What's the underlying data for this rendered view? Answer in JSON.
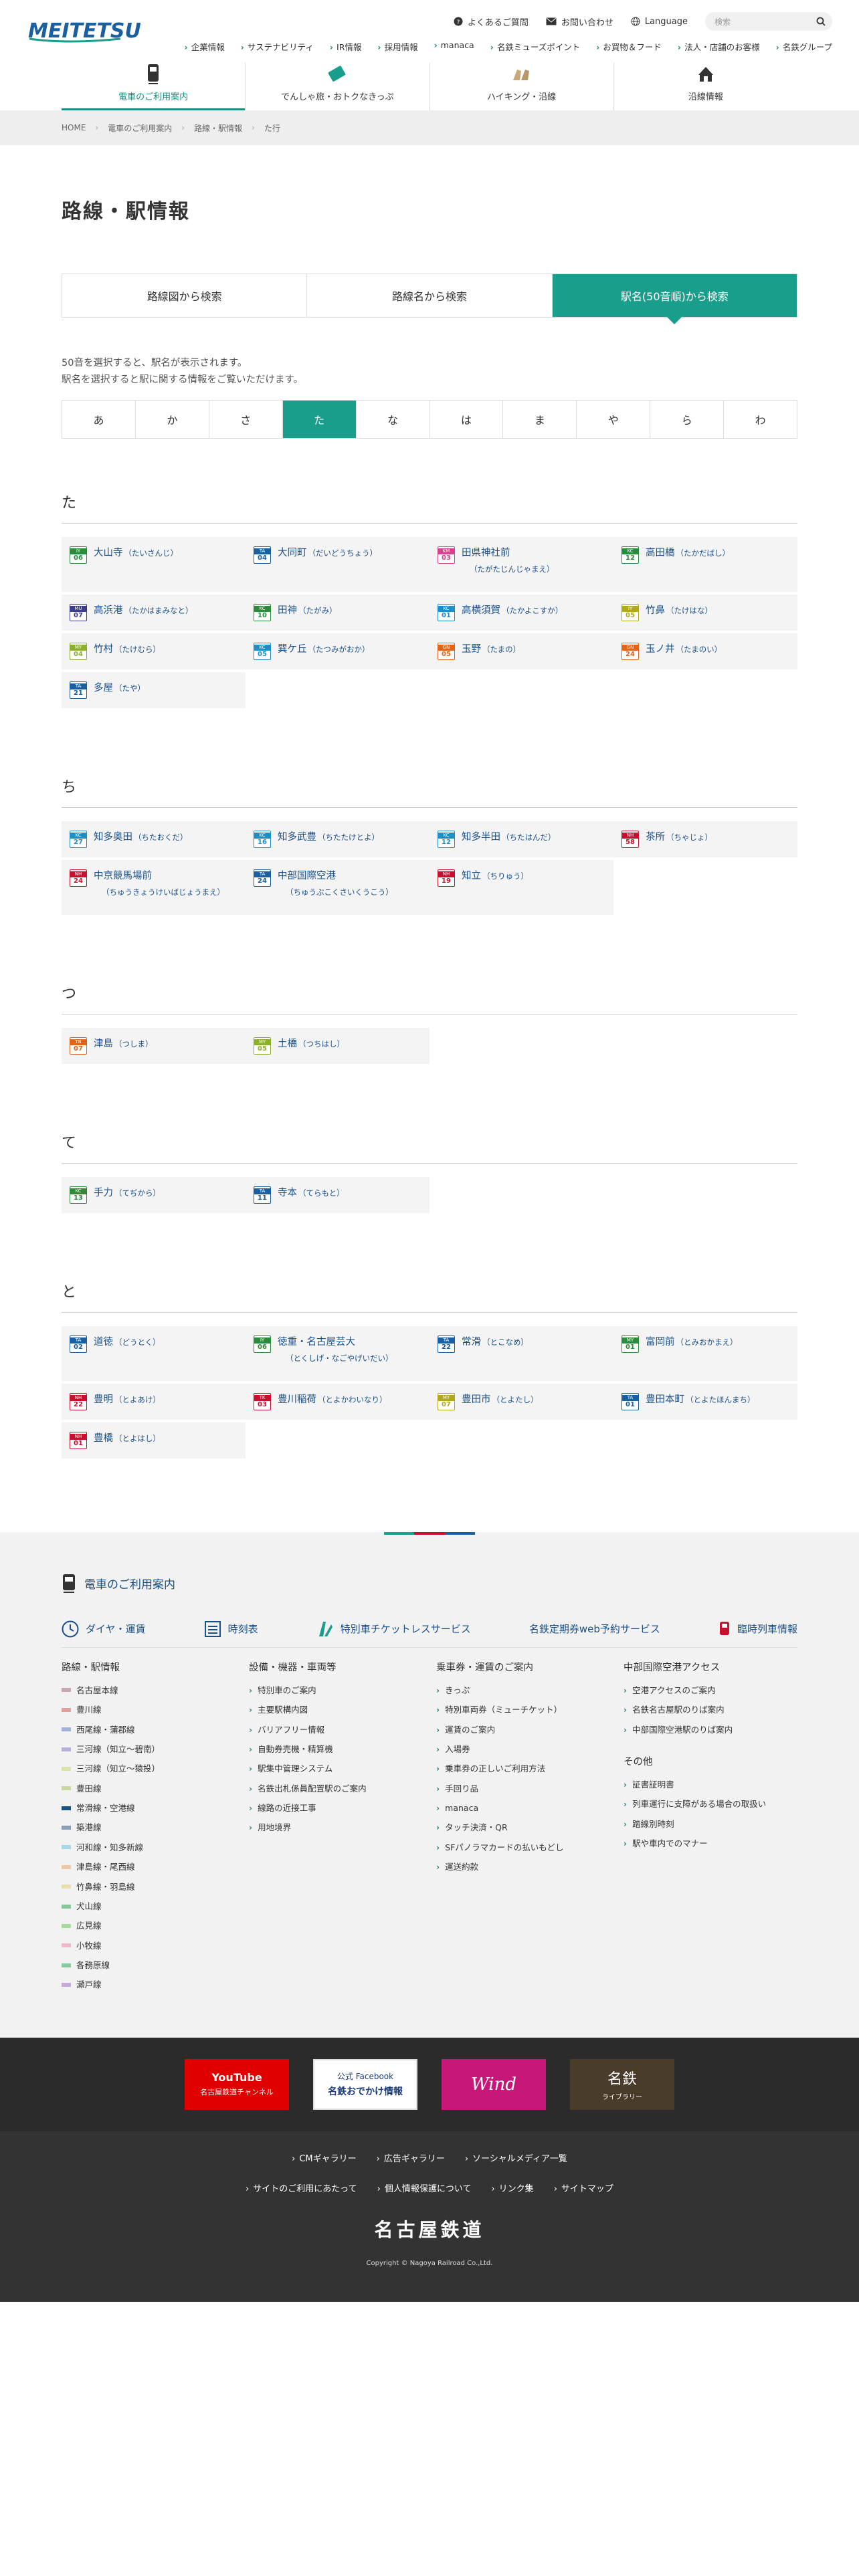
{
  "header": {
    "logo_text": "MEITETSU",
    "utils": [
      "よくあるご質問",
      "お問い合わせ",
      "Language"
    ],
    "search_placeholder": "検索",
    "subnav": [
      "企業情報",
      "サステナビリティ",
      "IR情報",
      "採用情報",
      "manaca",
      "名鉄ミューズポイント",
      "お買物＆フード",
      "法人・店舗のお客様",
      "名鉄グループ"
    ],
    "mainnav": [
      "電車のご利用案内",
      "でんしゃ旅・おトクなきっぷ",
      "ハイキング・沿線",
      "沿線情報"
    ]
  },
  "breadcrumb": [
    "HOME",
    "電車のご利用案内",
    "路線・駅情報",
    "た行"
  ],
  "page_title": "路線・駅情報",
  "tabs": [
    "路線図から検索",
    "路線名から検索",
    "駅名(50音順)から検索"
  ],
  "desc": [
    "50音を選択すると、駅名が表示されます。",
    "駅名を選択すると駅に関する情報をご覧いただけます。"
  ],
  "kana": [
    "あ",
    "か",
    "さ",
    "た",
    "な",
    "は",
    "ま",
    "や",
    "ら",
    "わ"
  ],
  "groups": [
    {
      "heading": "た",
      "stations": [
        {
          "code": "IY",
          "num": "06",
          "name": "大山寺",
          "reading": "（たいさんじ）",
          "color": "#2a8c3a"
        },
        {
          "code": "TA",
          "num": "04",
          "name": "大同町",
          "reading": "（だいどうちょう）",
          "color": "#1a5fa0"
        },
        {
          "code": "KM",
          "num": "03",
          "name": "田県神社前",
          "reading": "（たがたじんじゃまえ）",
          "color": "#d4418e",
          "tall": true
        },
        {
          "code": "KC",
          "num": "12",
          "name": "高田橋",
          "reading": "（たかだばし）",
          "color": "#2a8c3a"
        },
        {
          "code": "MU",
          "num": "07",
          "name": "高浜港",
          "reading": "（たかはまみなと）",
          "color": "#3d3d8f"
        },
        {
          "code": "KC",
          "num": "10",
          "name": "田神",
          "reading": "（たがみ）",
          "color": "#2a8c3a"
        },
        {
          "code": "KC",
          "num": "01",
          "name": "高横須賀",
          "reading": "（たかよこすか）",
          "color": "#1a8fc9"
        },
        {
          "code": "IY",
          "num": "05",
          "name": "竹鼻",
          "reading": "（たけはな）",
          "color": "#b0a91e"
        },
        {
          "code": "MY",
          "num": "04",
          "name": "竹村",
          "reading": "（たけむら）",
          "color": "#8ab02c"
        },
        {
          "code": "KC",
          "num": "05",
          "name": "巽ケ丘",
          "reading": "（たつみがおか）",
          "color": "#1a8fc9"
        },
        {
          "code": "GN",
          "num": "05",
          "name": "玉野",
          "reading": "（たまの）",
          "color": "#e0641a"
        },
        {
          "code": "GN",
          "num": "24",
          "name": "玉ノ井",
          "reading": "（たまのい）",
          "color": "#e0641a"
        },
        {
          "code": "TA",
          "num": "21",
          "name": "多屋",
          "reading": "（たや）",
          "color": "#1a5fa0"
        }
      ]
    },
    {
      "heading": "ち",
      "stations": [
        {
          "code": "KC",
          "num": "27",
          "name": "知多奥田",
          "reading": "（ちたおくだ）",
          "color": "#1a8fc9"
        },
        {
          "code": "KC",
          "num": "16",
          "name": "知多武豊",
          "reading": "（ちたたけとよ）",
          "color": "#1a8fc9"
        },
        {
          "code": "KC",
          "num": "12",
          "name": "知多半田",
          "reading": "（ちたはんだ）",
          "color": "#1a8fc9"
        },
        {
          "code": "NH",
          "num": "58",
          "name": "茶所",
          "reading": "（ちゃじょ）",
          "color": "#c8102e"
        },
        {
          "code": "NH",
          "num": "24",
          "name": "中京競馬場前",
          "reading": "（ちゅうきょうけいばじょうまえ）",
          "color": "#c8102e",
          "tall": true
        },
        {
          "code": "TA",
          "num": "24",
          "name": "中部国際空港",
          "reading": "（ちゅうぶこくさいくうこう）",
          "color": "#1a5fa0",
          "tall": true
        },
        {
          "code": "NH",
          "num": "19",
          "name": "知立",
          "reading": "（ちりゅう）",
          "color": "#c8102e"
        }
      ]
    },
    {
      "heading": "つ",
      "stations": [
        {
          "code": "TB",
          "num": "07",
          "name": "津島",
          "reading": "（つしま）",
          "color": "#e0641a"
        },
        {
          "code": "MY",
          "num": "05",
          "name": "土橋",
          "reading": "（つちはし）",
          "color": "#8ab02c"
        }
      ]
    },
    {
      "heading": "て",
      "stations": [
        {
          "code": "KC",
          "num": "13",
          "name": "手力",
          "reading": "（てぢから）",
          "color": "#2a8c3a"
        },
        {
          "code": "TA",
          "num": "11",
          "name": "寺本",
          "reading": "（てらもと）",
          "color": "#1a5fa0"
        }
      ]
    },
    {
      "heading": "と",
      "stations": [
        {
          "code": "TA",
          "num": "02",
          "name": "道徳",
          "reading": "（どうとく）",
          "color": "#1a5fa0"
        },
        {
          "code": "IY",
          "num": "06",
          "name": "徳重・名古屋芸大",
          "reading": "（とくしげ・なごやげいだい）",
          "color": "#2a8c3a",
          "tall": true
        },
        {
          "code": "TA",
          "num": "22",
          "name": "常滑",
          "reading": "（とこなめ）",
          "color": "#1a5fa0"
        },
        {
          "code": "MY",
          "num": "01",
          "name": "富岡前",
          "reading": "（とみおかまえ）",
          "color": "#2a8c3a"
        },
        {
          "code": "NH",
          "num": "22",
          "name": "豊明",
          "reading": "（とよあけ）",
          "color": "#c8102e"
        },
        {
          "code": "TK",
          "num": "03",
          "name": "豊川稲荷",
          "reading": "（とよかわいなり）",
          "color": "#c8102e"
        },
        {
          "code": "MY",
          "num": "07",
          "name": "豊田市",
          "reading": "（とよたし）",
          "color": "#b0a91e"
        },
        {
          "code": "TA",
          "num": "01",
          "name": "豊田本町",
          "reading": "（とよたほんまち）",
          "color": "#1a5fa0"
        },
        {
          "code": "NH",
          "num": "01",
          "name": "豊橋",
          "reading": "（とよはし）",
          "color": "#c8102e"
        }
      ]
    }
  ],
  "footer_nav": {
    "title": "電車のご利用案内",
    "links": [
      "ダイヤ・運賃",
      "時刻表",
      "特別車チケットレスサービス",
      "名鉄定期券web予約サービス",
      "臨時列車情報"
    ],
    "col1": {
      "heading": "路線・駅情報",
      "items": [
        {
          "label": "名古屋本線",
          "color": "#c8a7b0"
        },
        {
          "label": "豊川線",
          "color": "#e0a0a0"
        },
        {
          "label": "西尾線・蒲郡線",
          "color": "#a0b4d8"
        },
        {
          "label": "三河線（知立〜碧南）",
          "color": "#b8b0d8"
        },
        {
          "label": "三河線（知立〜猿投）",
          "color": "#dce3a8"
        },
        {
          "label": "豊田線",
          "color": "#c8d8a0"
        },
        {
          "label": "常滑線・空港線",
          "color": "#1a4f8a"
        },
        {
          "label": "築港線",
          "color": "#8aa0b8"
        },
        {
          "label": "河和線・知多新線",
          "color": "#a8d8e8"
        },
        {
          "label": "津島線・尾西線",
          "color": "#f0c8a8"
        },
        {
          "label": "竹鼻線・羽島線",
          "color": "#e8e0a8"
        },
        {
          "label": "犬山線",
          "color": "#88c898"
        },
        {
          "label": "広見線",
          "color": "#a8d8a0"
        },
        {
          "label": "小牧線",
          "color": "#f0b8c8"
        },
        {
          "label": "各務原線",
          "color": "#8ac8a0"
        },
        {
          "label": "瀬戸線",
          "color": "#c8a8d8"
        }
      ]
    },
    "col2": {
      "heading": "設備・機器・車両等",
      "items": [
        "特別車のご案内",
        "主要駅構内図",
        "バリアフリー情報",
        "自動券売機・精算機",
        "駅集中管理システム",
        "名鉄出札係員配置駅のご案内",
        "線路の近接工事",
        "用地境界"
      ]
    },
    "col3": {
      "heading": "乗車券・運賃のご案内",
      "items": [
        "きっぷ",
        "特別車両券（ミューチケット）",
        "運賃のご案内",
        "入場券",
        "乗車券の正しいご利用方法",
        "手回り品",
        "manaca",
        "タッチ決済・QR",
        "SFパノラマカードの払いもどし",
        "運送約款"
      ]
    },
    "col4": {
      "heading": "中部国際空港アクセス",
      "items": [
        "空港アクセスのご案内",
        "名鉄名古屋駅のりば案内",
        "中部国際空港駅のりば案内"
      ],
      "heading2": "その他",
      "items2": [
        "証書証明書",
        "列車運行に支障がある場合の取扱い",
        "踏線別時刻",
        "駅や車内でのマナー"
      ]
    }
  },
  "banners": {
    "youtube": "名古屋鉄道チャンネル",
    "youtube_logo": "YouTube",
    "facebook_title": "公式 Facebook",
    "facebook_sub": "名鉄おでかけ情報",
    "wind": "Wind",
    "library": "名鉄",
    "library_sub": "ライブラリー"
  },
  "footer": {
    "row1": [
      "CMギャラリー",
      "広告ギャラリー",
      "ソーシャルメディア一覧"
    ],
    "row2": [
      "サイトのご利用にあたって",
      "個人情報保護について",
      "リンク集",
      "サイトマップ"
    ],
    "corp": "名古屋鉄道",
    "copyright": "Copyright © Nagoya Railroad Co.,Ltd."
  }
}
